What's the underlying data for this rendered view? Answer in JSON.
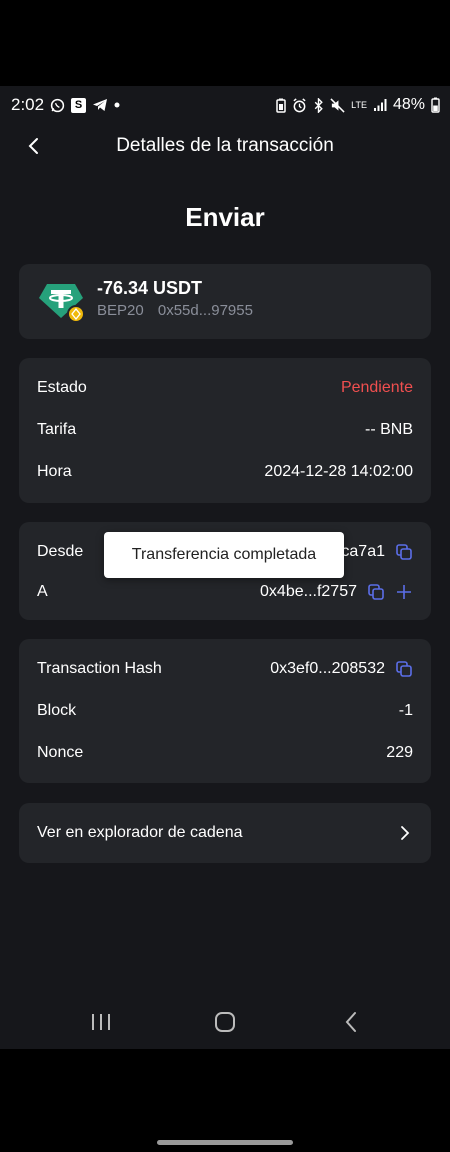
{
  "status_bar": {
    "time": "2:02",
    "battery": "48%",
    "lte": "LTE"
  },
  "header": {
    "title": "Detalles de la transacción"
  },
  "page_title": "Enviar",
  "token": {
    "amount": "-76.34 USDT",
    "network": "BEP20",
    "address": "0x55d...97955"
  },
  "info": {
    "status_label": "Estado",
    "status_value": "Pendiente",
    "fee_label": "Tarifa",
    "fee_value": "-- BNB",
    "time_label": "Hora",
    "time_value": "2024-12-28 14:02:00"
  },
  "addresses": {
    "from_label": "Desde",
    "from_value": "ca7a1",
    "to_label": "A",
    "to_value": "0x4be...f2757"
  },
  "hash": {
    "hash_label": "Transaction Hash",
    "hash_value": "0x3ef0...208532",
    "block_label": "Block",
    "block_value": "-1",
    "nonce_label": "Nonce",
    "nonce_value": "229"
  },
  "explorer": {
    "label": "Ver en explorador de cadena"
  },
  "toast": {
    "message": "Transferencia completada"
  },
  "colors": {
    "background": "#16171b",
    "card": "#232529",
    "pending": "#f04f4f",
    "icon_blue": "#5b6ee8",
    "tether": "#26a17b"
  },
  "icons": [
    "whatsapp-icon",
    "s-app-icon",
    "telegram-icon",
    "battery-saver-icon",
    "alarm-icon",
    "bluetooth-icon",
    "mute-icon",
    "signal-icon",
    "back-icon",
    "copy-icon",
    "plus-icon",
    "chevron-right-icon",
    "recents-icon",
    "home-icon",
    "nav-back-icon"
  ]
}
